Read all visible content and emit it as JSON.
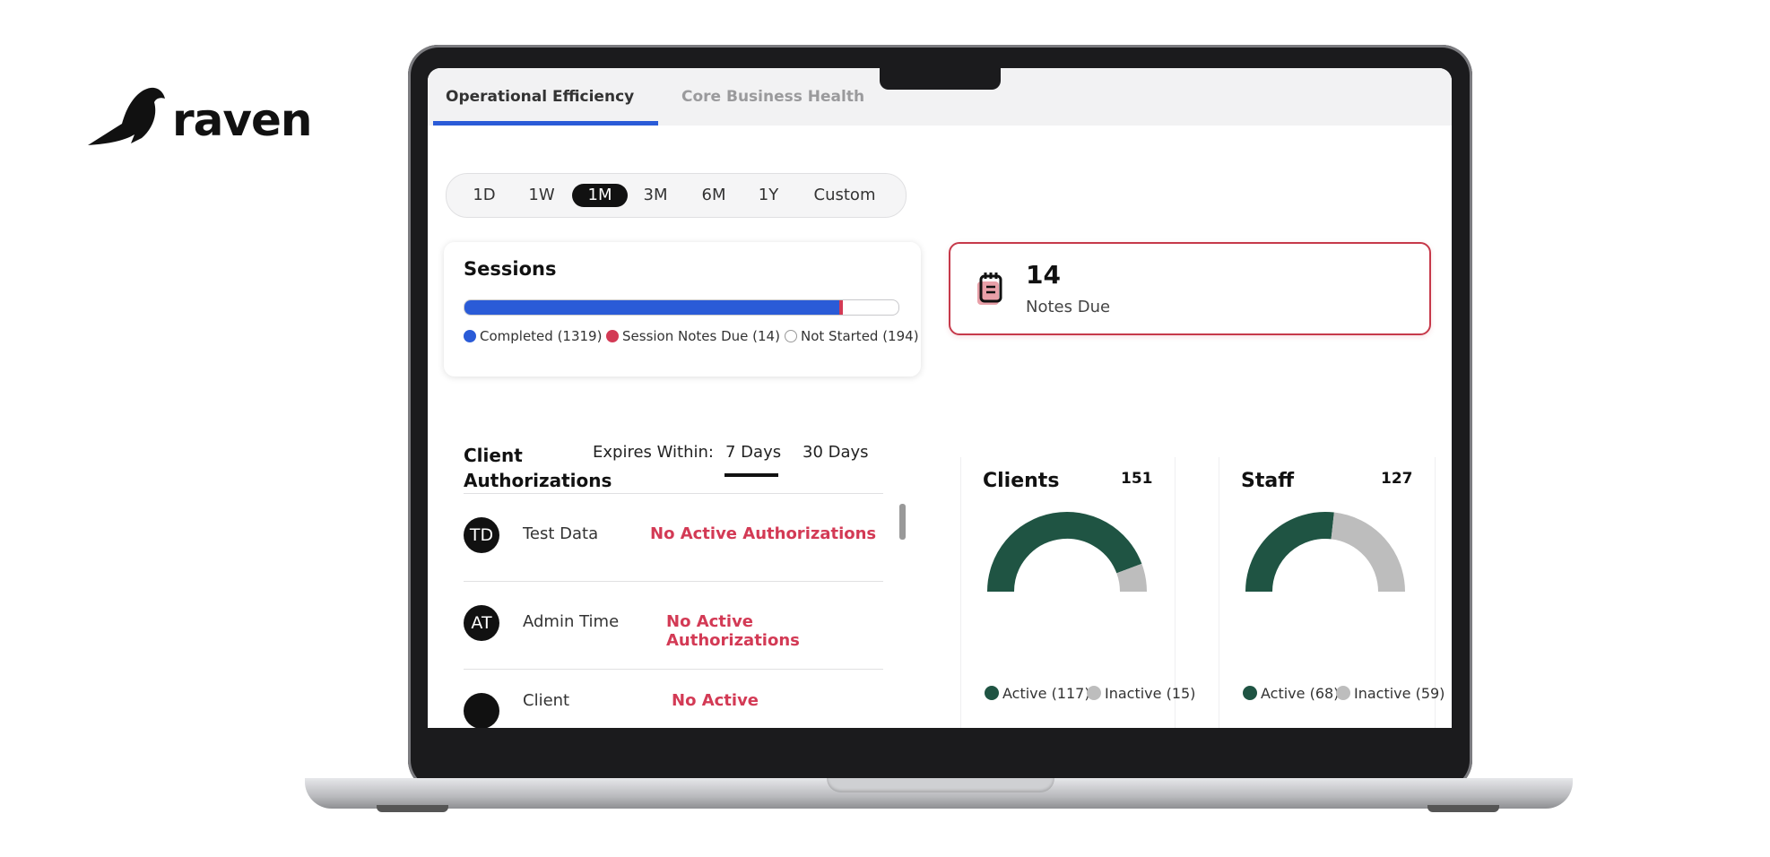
{
  "brand": {
    "name": "raven"
  },
  "tabs": [
    {
      "label": "Operational Efficiency",
      "active": true
    },
    {
      "label": "Core Business Health",
      "active": false
    }
  ],
  "ranges": {
    "options": [
      "1D",
      "1W",
      "1M",
      "3M",
      "6M",
      "1Y",
      "Custom"
    ],
    "selected": "1M"
  },
  "sessions": {
    "title": "Sessions",
    "completed": {
      "label": "Completed (1319)",
      "value": 1319,
      "color": "#2a5bd7"
    },
    "notes_due": {
      "label": "Session Notes Due (14)",
      "value": 14,
      "color": "#d33a55"
    },
    "not_started": {
      "label": "Not Started (194)",
      "value": 194,
      "color": "#ffffff"
    }
  },
  "notes_due_card": {
    "count": "14",
    "label": "Notes Due",
    "icon": "notepad-icon"
  },
  "authorizations": {
    "title_line1": "Client",
    "title_line2": "Authorizations",
    "expires_label": "Expires Within:",
    "options": [
      "7 Days",
      "30 Days"
    ],
    "selected": "7 Days",
    "rows": [
      {
        "initials": "TD",
        "name": "Test Data",
        "status": "No Active Authorizations"
      },
      {
        "initials": "AT",
        "name": "Admin Time",
        "status": "No Active Authorizations"
      },
      {
        "initials": "",
        "name": "Client",
        "status": "No Active"
      }
    ]
  },
  "clients": {
    "title": "Clients",
    "total": "151",
    "active": {
      "label": "Active (117)",
      "value": 117
    },
    "inactive": {
      "label": "Inactive (15)",
      "value": 15
    }
  },
  "staff": {
    "title": "Staff",
    "total": "127",
    "active": {
      "label": "Active (68)",
      "value": 68
    },
    "inactive": {
      "label": "Inactive (59)",
      "value": 59
    }
  },
  "colors": {
    "accent_blue": "#2a5bd7",
    "alert_red": "#d33a55",
    "donut_active": "#1f5443",
    "donut_inactive": "#bdbdbd"
  }
}
